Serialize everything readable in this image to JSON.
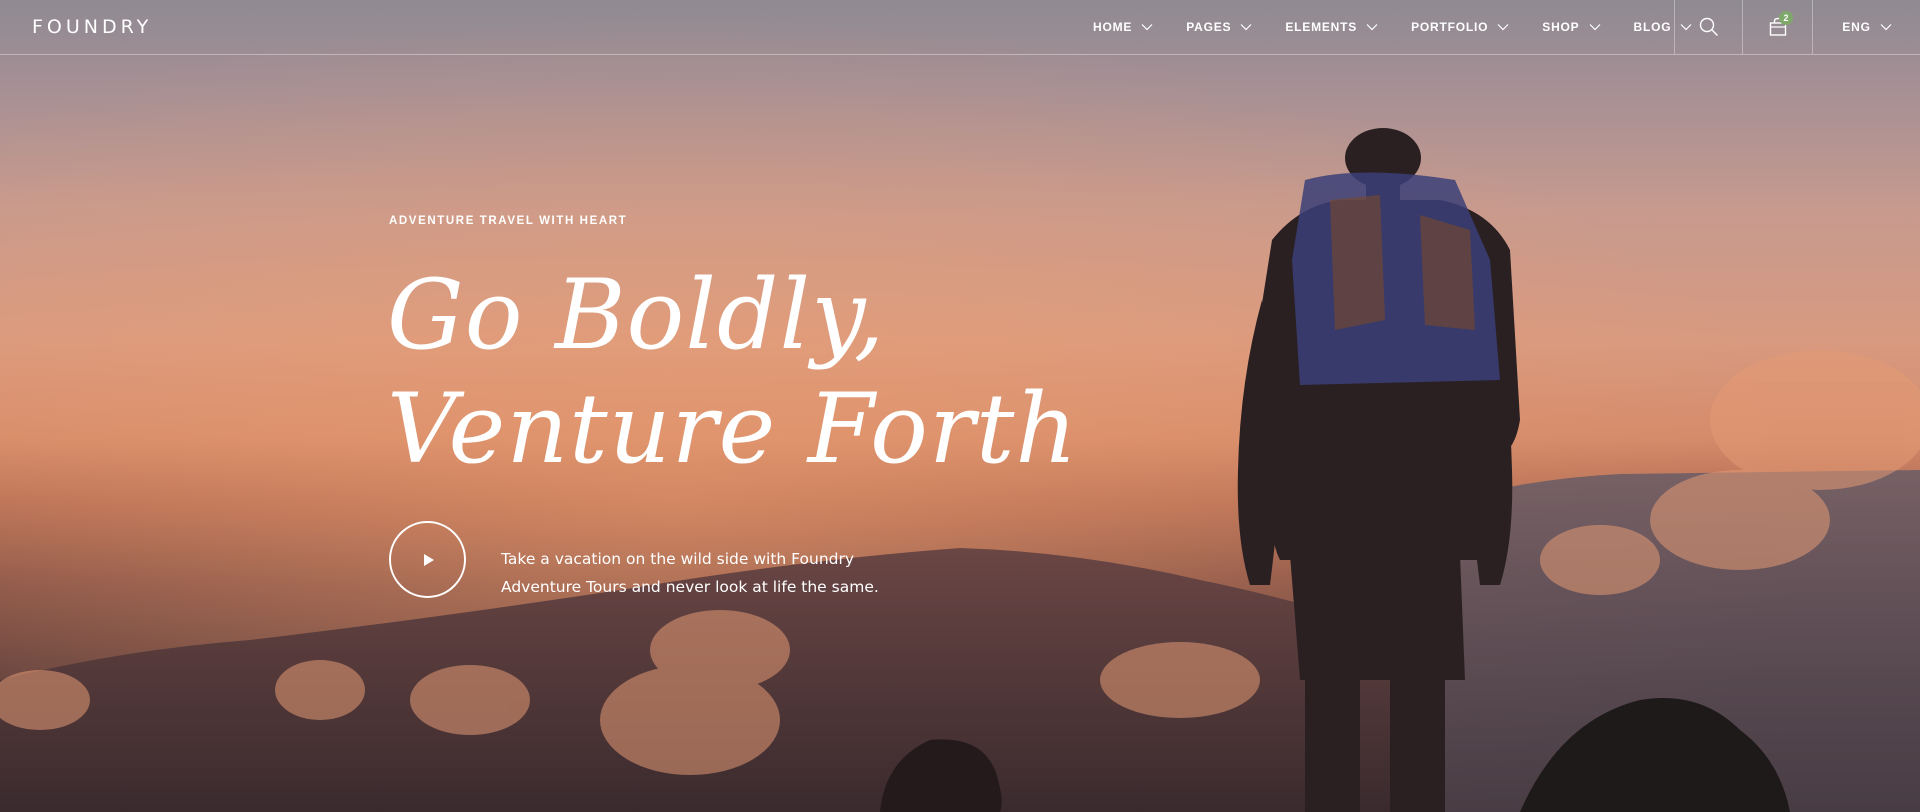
{
  "brand": {
    "name": "FOUNDRY"
  },
  "nav": {
    "items": [
      {
        "label": "HOME"
      },
      {
        "label": "PAGES"
      },
      {
        "label": "ELEMENTS"
      },
      {
        "label": "PORTFOLIO"
      },
      {
        "label": "SHOP"
      },
      {
        "label": "BLOG"
      }
    ]
  },
  "header": {
    "search_icon": "search-icon",
    "cart_icon": "shopping-bag-icon",
    "cart_count": "2",
    "language": "ENG",
    "badge_color": "#7fa86b"
  },
  "hero": {
    "eyebrow": "ADVENTURE TRAVEL WITH HEART",
    "headline_line1": "Go Boldly,",
    "headline_line2": "Venture Forth",
    "lead": "Take a vacation on the wild side with Foundry Adventure Tours and never look at life the same.",
    "play_icon": "play-icon"
  }
}
